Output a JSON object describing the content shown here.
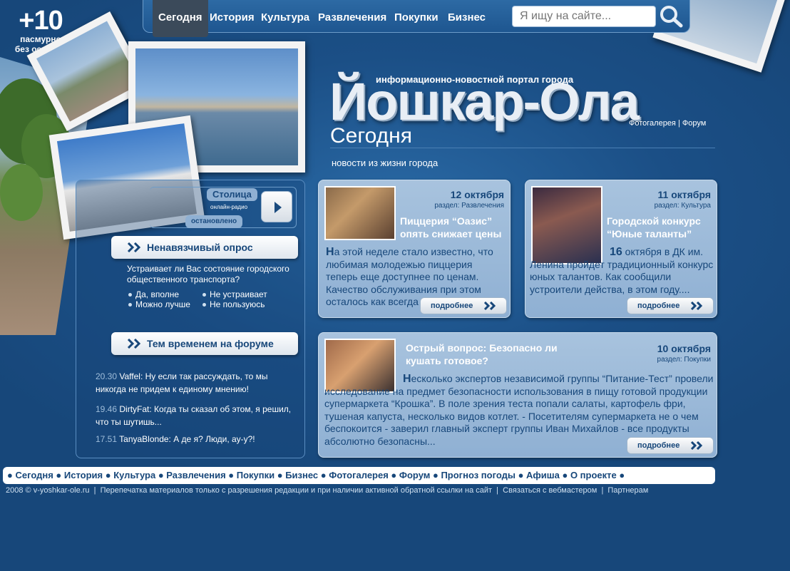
{
  "weather": {
    "temp": "+10",
    "line1": "пасмурно",
    "line2": "без осадков"
  },
  "topnav": {
    "items": [
      "Сегодня",
      "История",
      "Культура",
      "Развлечения",
      "Покупки",
      "Бизнес"
    ],
    "search_placeholder": "Я ищу на сайте..."
  },
  "header": {
    "tagline": "информационно-новостной портал города",
    "title": "Йошкар-Ола",
    "subtitle": "Сегодня",
    "slogan": "новости из жизни города",
    "photogallery": "Фотогалерея",
    "separator": "|",
    "forum": "Форум"
  },
  "radio": {
    "name": "Столица",
    "type": "онлайн-радио",
    "status": "остановлено"
  },
  "poll": {
    "heading": "Ненавязчивый опрос",
    "question": "Устраивает ли Вас состояние городского общественного транспорта?",
    "options": [
      "Да, вполне",
      "Не устраивает",
      "Можно лучше",
      "Не пользуюсь"
    ]
  },
  "forum": {
    "heading": "Тем временем на форуме",
    "posts": [
      {
        "time": "20.30",
        "author": "Vaffel",
        "text": "Ну если так рассуждать, то мы никогда не придем к единому мнению!"
      },
      {
        "time": "19.46",
        "author": "DirtyFat",
        "text": "Когда ты сказал об этом, я решил, что ты шутишь..."
      },
      {
        "time": "17.51",
        "author": "TanyaBlonde",
        "text": "А де я? Люди, ау-у?!"
      }
    ]
  },
  "news": [
    {
      "date": "12 октября",
      "rubric": "раздел: Развлечения",
      "title": "Пиццерия “Оазис” опять снижает цены",
      "lead_letter": "Н",
      "body": "а этой неделе стало известно, что любимая молодежью пиццерия теперь еще доступнее по ценам. Качество обслуживания при этом осталось как всегда на высоте...",
      "more": "подробнее"
    },
    {
      "date": "11 октября",
      "rubric": "раздел: Культура",
      "title": "Городской конкурс “Юные таланты”",
      "lead_letter": "16",
      "body": " октября в ДК им. Ленина пройдет традиционный конкурс юных талантов. Как сообщили устроители действа, в этом году....",
      "more": "подробнее"
    },
    {
      "date": "10 октября",
      "rubric": "раздел: Покупки",
      "title": "Острый вопрос: Безопасно ли кушать готовое?",
      "lead_letter": "Н",
      "body": "есколько экспертов независимой группы “Питание-Тест” провели исследование на предмет безопасности использования в пищу готовой продукции супермаркета “Крошка”. В поле зрения теста попали салаты, картофель фри, тушеная капуста, несколько видов котлет. - Посетителям супермаркета не о чем беспокоится - заверил главный эксперт группы Иван Михайлов - все продукты абсолютно безопасны...",
      "more": "подробнее"
    }
  ],
  "bottomnav": [
    "Сегодня",
    "История",
    "Культура",
    "Развлечения",
    "Покупки",
    "Бизнес",
    "Фотогалерея",
    "Форум",
    "Прогноз погоды",
    "Афиша",
    "О проекте"
  ],
  "footer": {
    "copyright": "2008 © v-yoshkar-ole.ru",
    "notice": "Перепечатка материалов только с разрешения редакции и при наличии активной обратной ссылки на сайт",
    "contact": "Связаться с вебмастером",
    "partners": "Партнерам"
  },
  "colors": {
    "background": "#17477a",
    "accent": "#1a4a7e",
    "card": "#9cb9d8"
  }
}
